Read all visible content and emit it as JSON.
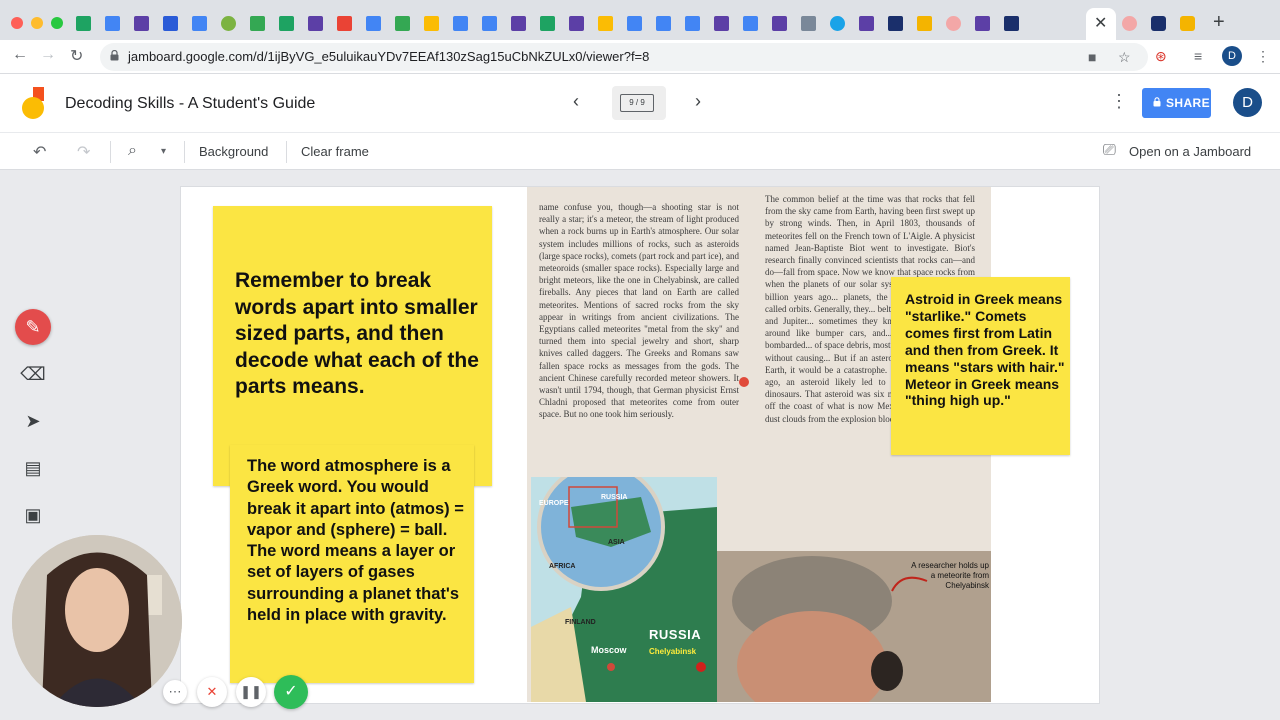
{
  "browser": {
    "url": "jamboard.google.com/d/1ijByVG_e5uluikauYDv7EEAf130zSag15uCbNkZULx0/viewer?f=8",
    "profile_initial": "D"
  },
  "header": {
    "title": "Decoding Skills - A Student's Guide",
    "frame_indicator": "9 / 9",
    "share_label": "SHARE",
    "user_initial": "D"
  },
  "toolbar": {
    "background_label": "Background",
    "clear_frame_label": "Clear frame",
    "open_on_jamboard_label": "Open on a Jamboard"
  },
  "notes": {
    "note1": "Remember to break words apart into smaller sized parts, and then decode what each of the parts means.",
    "note2": "The word atmosphere is a Greek word.  You would break it apart into (atmos) = vapor and (sphere) = ball.  The word means a layer or set of layers of gases surrounding a planet that's held in place with gravity.",
    "note3": "Astroid in Greek means \"starlike.\" Comets comes first from Latin and then from Greek.  It means \"stars with hair.\"  Meteor in Greek means \"thing high up.\""
  },
  "book": {
    "col1": "name confuse you, though—a shooting star is not really a star; it's a meteor, the stream of light produced when a rock burns up in Earth's atmosphere. Our solar system includes millions of rocks, such as asteroids (large space rocks), comets (part rock and part ice), and meteoroids (smaller space rocks). Especially large and bright meteors, like the one in Chelyabinsk, are called fireballs. Any pieces that land on Earth are called meteorites. Mentions of sacred rocks from the sky appear in writings from ancient civilizations. The Egyptians called meteorites \"metal from the sky\" and turned them into special jewelry and short, sharp knives called daggers. The Greeks and Romans saw fallen space rocks as messages from the gods. The ancient Chinese carefully recorded meteor showers. It wasn't until 1794, though, that German physicist Ernst Chladni proposed that meteorites come from outer space. But no one took him seriously.",
    "col2": "The common belief at the time was that rocks that fell from the sky came from Earth, having been first swept up by strong winds. Then, in April 1803, thousands of meteorites fell on the French town of L'Aigle. A physicist named Jean-Baptiste Biot went to investigate. Biot's research finally convinced scientists that rocks can—and do—fall from space. Now we know that space rocks from when the planets of our solar system formed about 4.5 billion years ago... planets, the rocks move around... called orbits. Generally, they... belt, an area between Mars and Jupiter... sometimes they knock into each other... around like bumper cars, and... Each day, Earth is bombarded... of space debris, most of which... atmosphere without causing... But if an asteroid larger... were to hit Earth, it would be a catastrophe. Sixty-six million years ago, an asteroid likely led to the extinction of the dinosaurs. That asteroid was six miles across. It crashed off the coast of what is now Mexico. Scientists believe dust clouds from the explosion blocked",
    "map_russia": "RUSSIA",
    "map_russia_small": "RUSSIA",
    "map_moscow": "Moscow",
    "map_chelyabinsk": "Chelyabinsk",
    "map_finland": "FINLAND",
    "map_europe": "EUROPE",
    "map_asia": "ASIA",
    "map_africa": "AFRICA",
    "photo_caption": "A researcher holds up a meteorite from Chelyabinsk"
  },
  "colors": {
    "sticky": "#fbe543",
    "share": "#4285f4",
    "pen_active": "#e34c4c",
    "record_check": "#2ebd59"
  }
}
